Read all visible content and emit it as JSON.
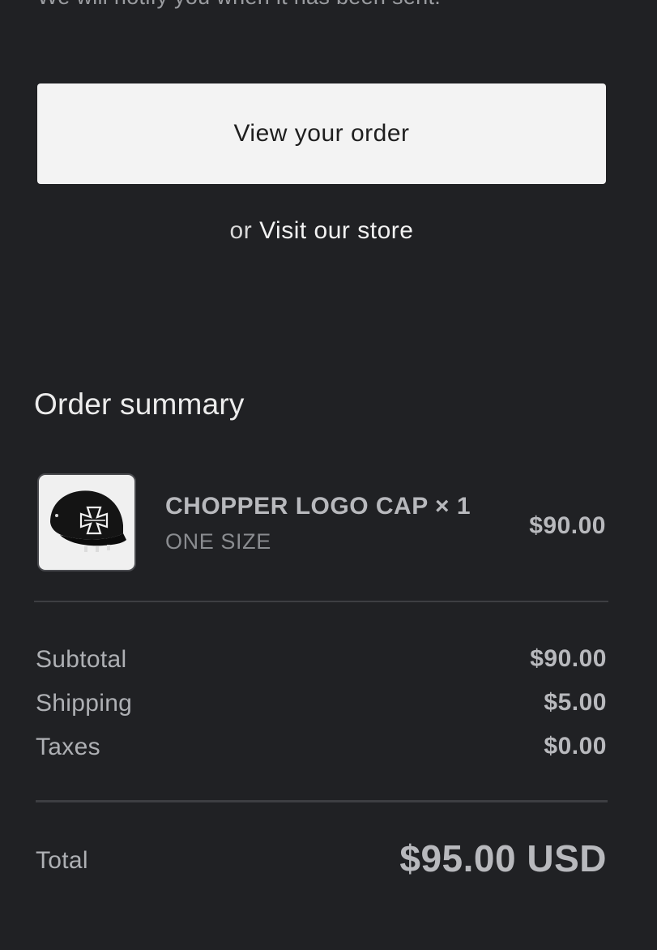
{
  "notice": {
    "text": "We will notify you when it has been sent."
  },
  "actions": {
    "view_order_label": "View your order",
    "or_text": "or",
    "visit_store_label": "Visit our store"
  },
  "summary": {
    "title": "Order summary",
    "item": {
      "name": "CHOPPER LOGO CAP × 1",
      "variant": "ONE SIZE",
      "price": "$90.00",
      "image_icon": "black-cap-product-image"
    },
    "rows": [
      {
        "label": "Subtotal",
        "value": "$90.00"
      },
      {
        "label": "Shipping",
        "value": "$5.00"
      },
      {
        "label": "Taxes",
        "value": "$0.00"
      }
    ],
    "total": {
      "label": "Total",
      "value": "$95.00 USD"
    }
  },
  "colors": {
    "background": "#202124",
    "button_bg": "#f3f3f3",
    "muted_text": "#b8b9bd"
  }
}
